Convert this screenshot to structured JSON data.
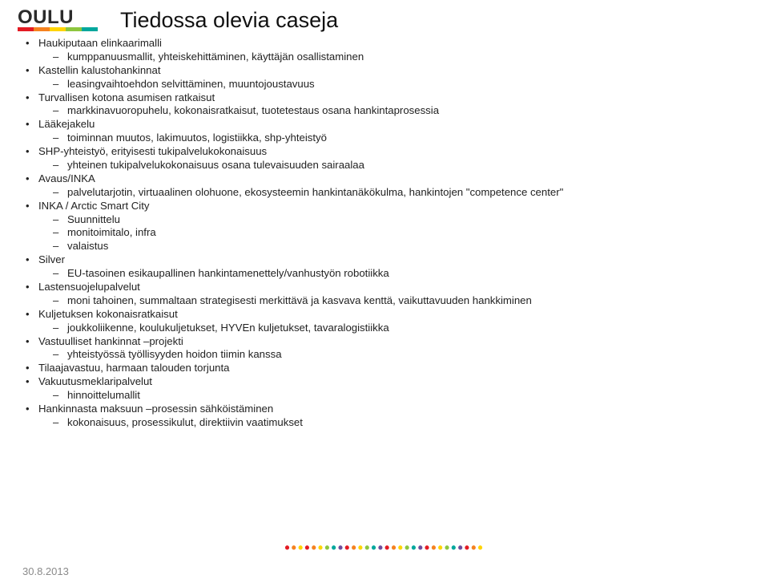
{
  "logo": {
    "text": "OULU"
  },
  "title": "Tiedossa olevia caseja",
  "items": [
    {
      "label": "Haukiputaan elinkaarimalli",
      "sub": [
        "kumppanuusmallit, yhteiskehittäminen, käyttäjän osallistaminen"
      ]
    },
    {
      "label": "Kastellin kalustohankinnat",
      "sub": [
        "leasingvaihtoehdon selvittäminen, muuntojoustavuus"
      ]
    },
    {
      "label": "Turvallisen kotona asumisen ratkaisut",
      "sub": [
        "markkinavuoropuhelu, kokonaisratkaisut, tuotetestaus osana hankintaprosessia"
      ]
    },
    {
      "label": "Lääkejakelu",
      "sub": [
        "toiminnan muutos, lakimuutos, logistiikka, shp-yhteistyö"
      ]
    },
    {
      "label": "SHP-yhteistyö, erityisesti tukipalvelukokonaisuus",
      "sub": [
        "yhteinen tukipalvelukokonaisuus osana tulevaisuuden sairaalaa"
      ]
    },
    {
      "label": "Avaus/INKA",
      "sub": [
        "palvelutarjotin, virtuaalinen olohuone, ekosysteemin hankintanäkökulma, hankintojen \"competence center\""
      ]
    },
    {
      "label": "INKA / Arctic Smart City",
      "sub": [
        "Suunnittelu",
        "monitoimitalo, infra",
        "valaistus"
      ]
    },
    {
      "label": "Silver",
      "sub": [
        "EU-tasoinen esikaupallinen hankintamenettely/vanhustyön robotiikka"
      ]
    },
    {
      "label": "Lastensuojelupalvelut",
      "sub": [
        "moni tahoinen, summaltaan strategisesti merkittävä ja kasvava kenttä, vaikuttavuuden hankkiminen"
      ]
    },
    {
      "label": "Kuljetuksen kokonaisratkaisut",
      "sub": [
        "joukkoliikenne, koulukuljetukset, HYVEn kuljetukset, tavaralogistiikka"
      ]
    },
    {
      "label": "Vastuulliset hankinnat –projekti",
      "sub": [
        "yhteistyössä työllisyyden hoidon tiimin kanssa"
      ]
    },
    {
      "label": "Tilaajavastuu, harmaan talouden torjunta",
      "sub": []
    },
    {
      "label": "Vakuutusmeklaripalvelut",
      "sub": [
        "hinnoittelumallit"
      ]
    },
    {
      "label": "Hankinnasta maksuun –prosessin sähköistäminen",
      "sub": [
        "kokonaisuus, prosessikulut, direktiivin vaatimukset"
      ]
    }
  ],
  "footer": {
    "date": "30.8.2013"
  }
}
